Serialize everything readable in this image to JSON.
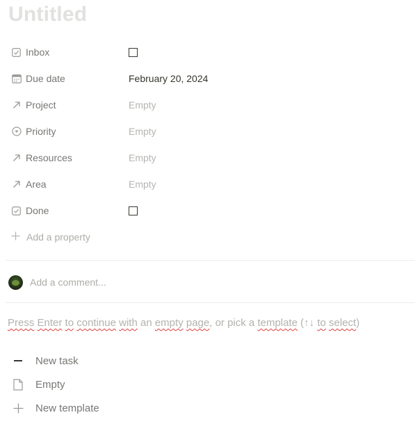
{
  "page": {
    "title": "Untitled"
  },
  "properties": [
    {
      "name": "Inbox",
      "icon": "checkbox-icon",
      "type": "checkbox",
      "value": "",
      "checked": false
    },
    {
      "name": "Due date",
      "icon": "calendar-icon",
      "type": "date",
      "value": "February 20, 2024"
    },
    {
      "name": "Project",
      "icon": "relation-arrow-icon",
      "type": "relation",
      "value": "Empty"
    },
    {
      "name": "Priority",
      "icon": "select-icon",
      "type": "select",
      "value": "Empty"
    },
    {
      "name": "Resources",
      "icon": "relation-arrow-icon",
      "type": "relation",
      "value": "Empty"
    },
    {
      "name": "Area",
      "icon": "relation-arrow-icon",
      "type": "relation",
      "value": "Empty"
    },
    {
      "name": "Done",
      "icon": "checkbox-icon",
      "type": "checkbox",
      "value": "",
      "checked": false
    }
  ],
  "add_property": {
    "label": "Add a property",
    "icon": "plus-icon"
  },
  "comment": {
    "placeholder": "Add a comment...",
    "avatar": "user-avatar"
  },
  "template_hint": {
    "parts": [
      "Press",
      " ",
      "Enter",
      " ",
      "to",
      " ",
      "continue",
      " ",
      "with",
      " an ",
      "empty",
      " ",
      "page",
      ", or pick a ",
      "template",
      " (↑↓ ",
      "to",
      " ",
      "select",
      ")"
    ]
  },
  "templates": [
    {
      "label": "New task",
      "icon": "dash-icon"
    },
    {
      "label": "Empty",
      "icon": "page-icon"
    },
    {
      "label": "New template",
      "icon": "plus-icon"
    }
  ],
  "colors": {
    "text": "#37352f",
    "muted": "#787774",
    "placeholder": "#b6b5b2",
    "title_placeholder": "#e1e1df",
    "divider": "#ececeb",
    "spellcheck": "#e03e3e"
  }
}
